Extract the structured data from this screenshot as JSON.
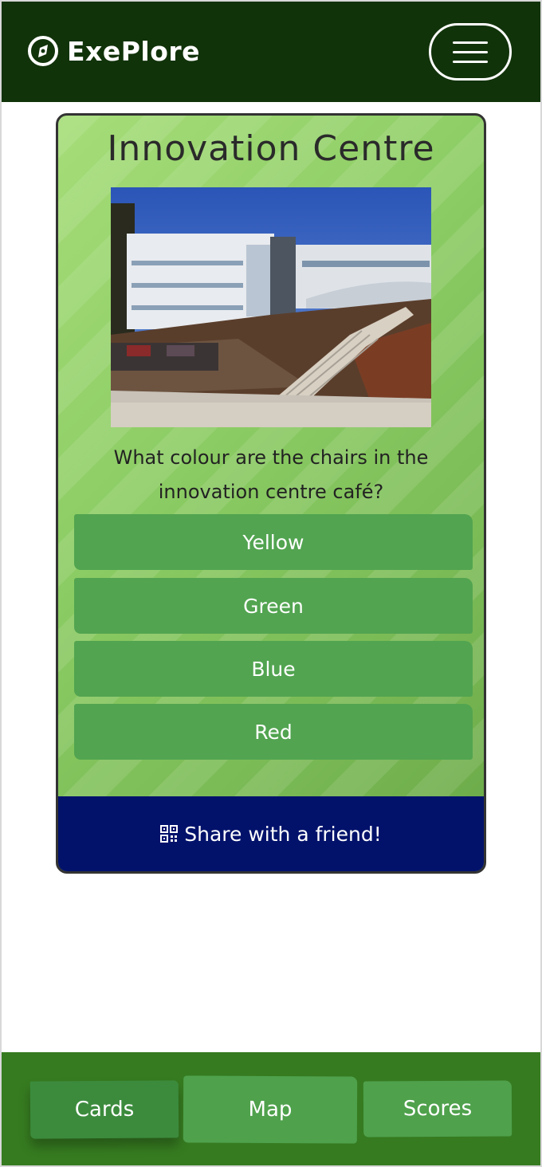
{
  "app": {
    "name": "ExePlore",
    "logo_icon": "compass-icon",
    "menu_icon": "hamburger-menu-icon"
  },
  "colors": {
    "header_bg": "#11330a",
    "card_green": "#8ccc64",
    "answer_bg": "#52a450",
    "share_bg": "#02126b",
    "bottom_nav_bg": "#367b20"
  },
  "card": {
    "title": "Innovation Centre",
    "photo_icon": "building-photo",
    "question": "What colour are the chairs in the innovation centre café?",
    "answers": [
      "Yellow",
      "Green",
      "Blue",
      "Red"
    ],
    "share_label": "Share with a friend!",
    "share_icon": "qr-code-icon"
  },
  "bottom_nav": {
    "tabs": [
      {
        "label": "Cards",
        "active": true
      },
      {
        "label": "Map",
        "active": false
      },
      {
        "label": "Scores",
        "active": false
      }
    ]
  }
}
